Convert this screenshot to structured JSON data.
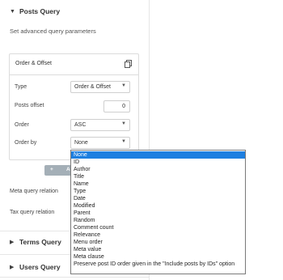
{
  "sections": {
    "posts_query": {
      "title": "Posts Query",
      "description": "Set advanced query parameters"
    },
    "terms_query": {
      "title": "Terms Query"
    },
    "users_query": {
      "title": "Users Query"
    }
  },
  "repeater_item": {
    "title": "Order & Offset",
    "fields": {
      "type": {
        "label": "Type",
        "value": "Order & Offset"
      },
      "posts_offset": {
        "label": "Posts offset",
        "value": "0"
      },
      "order": {
        "label": "Order",
        "value": "ASC"
      },
      "order_by": {
        "label": "Order by",
        "value": "None"
      }
    }
  },
  "add_button": {
    "label": "A"
  },
  "meta_query_relation": {
    "label": "Meta query relation"
  },
  "tax_query_relation": {
    "label": "Tax query relation"
  },
  "order_by_options": [
    "None",
    "ID",
    "Author",
    "Title",
    "Name",
    "Type",
    "Date",
    "Modified",
    "Parent",
    "Random",
    "Comment count",
    "Relevance",
    "Menu order",
    "Meta value",
    "Meta clause",
    "Preserve post ID order given in the \"Include posts by IDs\" option"
  ],
  "selected_option_index": 0,
  "icons": {
    "caret_open": "triangle-down",
    "caret_closed": "triangle-right",
    "copy": "copy-icon",
    "select_arrow": "chevron-down"
  },
  "colors": {
    "selected_option": "#1e7fe0",
    "add_button": "#a4afb7"
  }
}
